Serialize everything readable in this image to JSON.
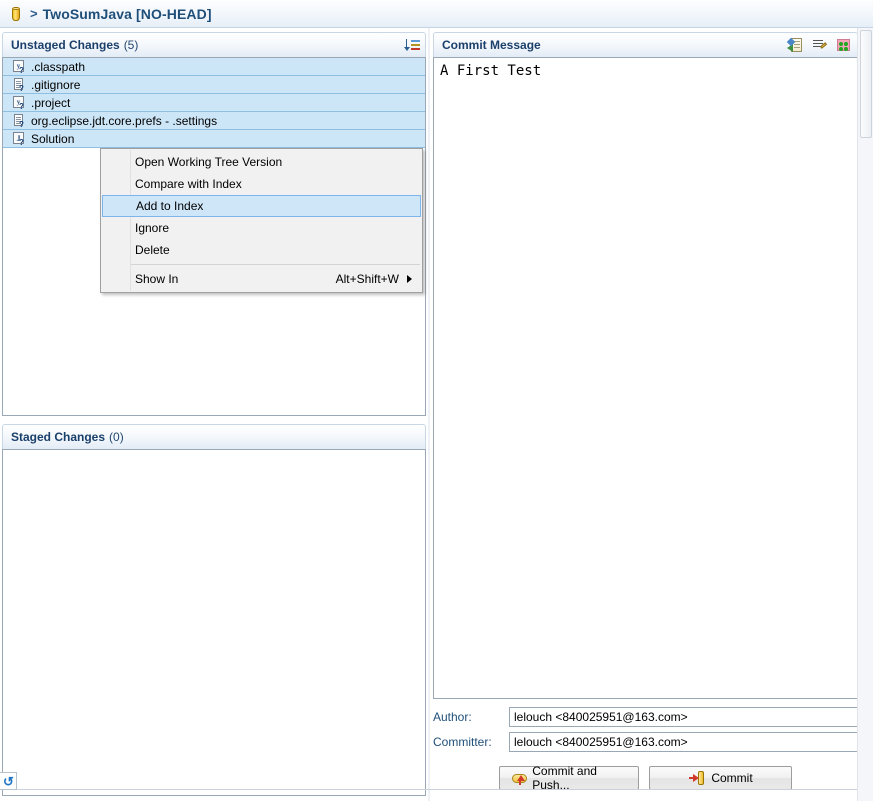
{
  "titlebar": {
    "repo_icon": "repository-cylinder-icon",
    "separator": ">",
    "title": "TwoSumJava [NO-HEAD]"
  },
  "unstaged": {
    "title": "Unstaged Changes",
    "count": "(5)",
    "sort_icon": "sort-icon",
    "files": [
      {
        "name": ".classpath",
        "icon": "xml-file-icon",
        "badge": "?",
        "glyph": "y"
      },
      {
        "name": ".gitignore",
        "icon": "text-file-icon",
        "badge": "?",
        "glyph": ""
      },
      {
        "name": ".project",
        "icon": "xml-file-icon",
        "badge": "?",
        "glyph": "y"
      },
      {
        "name": "org.eclipse.jdt.core.prefs - .settings",
        "icon": "text-file-icon",
        "badge": "?",
        "glyph": ""
      },
      {
        "name": "Solution",
        "icon": "java-file-icon",
        "badge": "?",
        "glyph": "J"
      }
    ]
  },
  "staged": {
    "title": "Staged Changes",
    "count": "(0)",
    "files": []
  },
  "commit": {
    "title": "Commit Message",
    "message": "A First Test",
    "tools": [
      {
        "icon": "amend-commit-icon",
        "name": "amend-commit-button"
      },
      {
        "icon": "add-signed-off-by-icon",
        "name": "signed-off-by-button"
      },
      {
        "icon": "add-change-id-icon",
        "name": "change-id-button"
      }
    ],
    "author_label": "Author:",
    "author_value": "lelouch <840025951@163.com>",
    "committer_label": "Committer:",
    "committer_value": "lelouch <840025951@163.com>",
    "commit_push_label": "Commit and Push...",
    "commit_label": "Commit"
  },
  "context_menu": {
    "items": [
      {
        "label": "Open Working Tree Version",
        "accel": "",
        "selected": false,
        "submenu": false
      },
      {
        "label": "Compare with Index",
        "accel": "",
        "selected": false,
        "submenu": false
      },
      {
        "label": "Add to Index",
        "accel": "",
        "selected": true,
        "submenu": false
      },
      {
        "label": "Ignore",
        "accel": "",
        "selected": false,
        "submenu": false
      },
      {
        "label": "Delete",
        "accel": "",
        "selected": false,
        "submenu": false
      },
      {
        "label": "Show In",
        "accel": "Alt+Shift+W",
        "selected": false,
        "submenu": true
      }
    ]
  },
  "status": {
    "refresh_icon": "refresh-icon"
  },
  "colors": {
    "accent": "#1f4e79",
    "selection": "#cde6f7",
    "menu_highlight": "#cfe6f8"
  }
}
